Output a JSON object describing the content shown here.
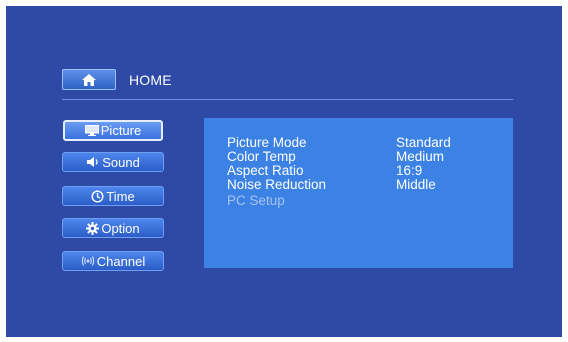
{
  "header": {
    "title": "HOME"
  },
  "menu": {
    "items": [
      {
        "label": "Picture"
      },
      {
        "label": "Sound"
      },
      {
        "label": "Time"
      },
      {
        "label": "Option"
      },
      {
        "label": "Channel"
      }
    ],
    "active_index": 0
  },
  "settings": {
    "rows": [
      {
        "label": "Picture Mode",
        "value": "Standard"
      },
      {
        "label": "Color Temp",
        "value": "Medium"
      },
      {
        "label": "Aspect Ratio",
        "value": "16:9"
      },
      {
        "label": "Noise Reduction",
        "value": "Middle"
      },
      {
        "label": "PC Setup",
        "value": ""
      }
    ],
    "disabled_row": "PC Setup"
  },
  "colors": {
    "background": "#2f49a6",
    "panel": "#3b82e4",
    "menu_button": "#2b5dc6",
    "disabled_text": "#a8c3ee"
  },
  "icons": {
    "home": "home-icon",
    "picture": "monitor-icon",
    "sound": "speaker-icon",
    "time": "clock-icon",
    "option": "gear-icon",
    "channel": "antenna-icon"
  }
}
